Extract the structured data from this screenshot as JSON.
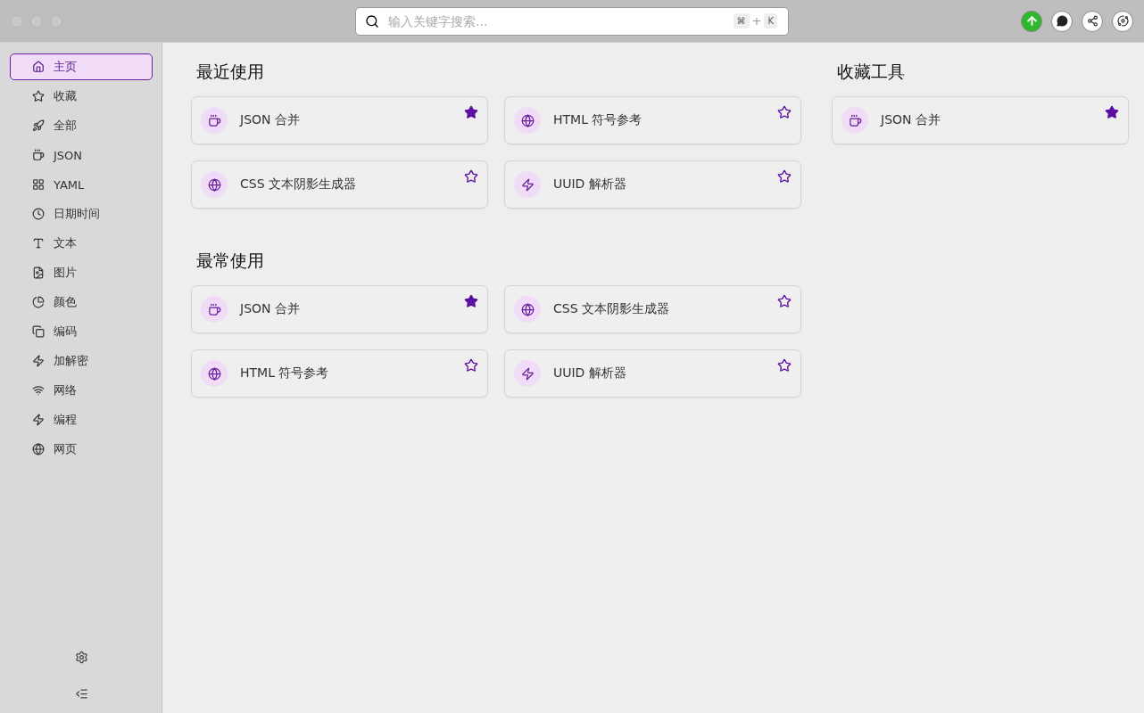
{
  "search": {
    "placeholder": "输入关键字搜索...",
    "shortcut": [
      "⌘",
      "+",
      "K"
    ]
  },
  "sidebar": {
    "items": [
      {
        "label": "主页",
        "selected": true
      },
      {
        "label": "收藏",
        "selected": false
      },
      {
        "label": "全部",
        "selected": false
      },
      {
        "label": "JSON",
        "selected": false
      },
      {
        "label": "YAML",
        "selected": false
      },
      {
        "label": "日期时间",
        "selected": false
      },
      {
        "label": "文本",
        "selected": false
      },
      {
        "label": "图片",
        "selected": false
      },
      {
        "label": "颜色",
        "selected": false
      },
      {
        "label": "编码",
        "selected": false
      },
      {
        "label": "加解密",
        "selected": false
      },
      {
        "label": "网络",
        "selected": false
      },
      {
        "label": "编程",
        "selected": false
      },
      {
        "label": "网页",
        "selected": false
      }
    ]
  },
  "sections": [
    {
      "title": "最近使用",
      "tools": [
        {
          "name": "JSON 合并",
          "kind": "json",
          "starred": true
        },
        {
          "name": "HTML 符号参考",
          "kind": "web",
          "starred": false
        },
        {
          "name": "CSS 文本阴影生成器",
          "kind": "web",
          "starred": false
        },
        {
          "name": "UUID 解析器",
          "kind": "code",
          "starred": false
        }
      ]
    },
    {
      "title": "最常使用",
      "tools": [
        {
          "name": "JSON 合并",
          "kind": "json",
          "starred": true
        },
        {
          "name": "CSS 文本阴影生成器",
          "kind": "web",
          "starred": false
        },
        {
          "name": "HTML 符号参考",
          "kind": "web",
          "starred": false
        },
        {
          "name": "UUID 解析器",
          "kind": "code",
          "starred": false
        }
      ]
    }
  ],
  "favorites": {
    "title": "收藏工具",
    "tools": [
      {
        "name": "JSON 合并",
        "kind": "json",
        "starred": true
      }
    ]
  }
}
